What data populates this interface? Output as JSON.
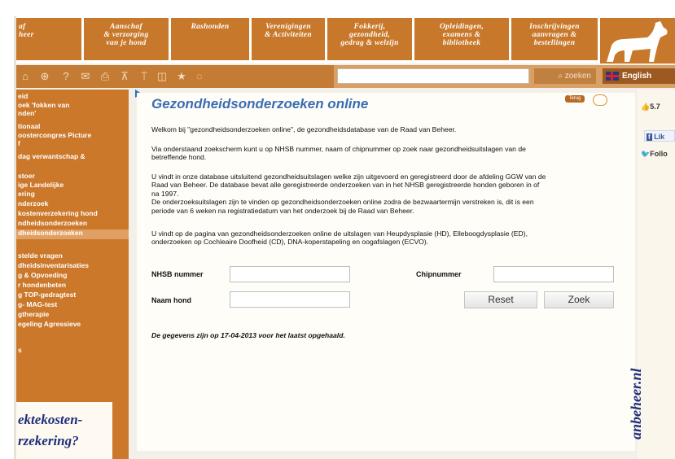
{
  "nav": {
    "items": [
      "af\nheer",
      "Aanschaf\n& verzorging\nvan je hond",
      "Rashonden",
      "Verenigingen\n& Activiteiten",
      "Fokkerij,\ngezondheid,\ngedrag & welzijn",
      "Opleidingen,\nexamens &\nbibliotheek",
      "Inschrijvingen\naanvragen &\nbestellingen"
    ]
  },
  "toolbar": {
    "icons": [
      "home-icon",
      "globe-icon",
      "help-icon",
      "mail-icon",
      "print-icon",
      "sitemap-icon",
      "pin-icon",
      "text-size-icon",
      "star-icon",
      "chat-icon"
    ],
    "search_button": "zoeken",
    "language": "English"
  },
  "sidebar": {
    "items": [
      "eid",
      "oek 'fokken van",
      "nden'",
      "tionaal",
      "oostercongres Picture",
      "f",
      "dag verwantschap &",
      "",
      "stoer",
      "ige Landelijke",
      "ering",
      "nderzoek",
      "kostenverzekering hond",
      "ndheidsonderzoeken",
      "dheidsonderzoeken",
      "",
      "stelde vragen",
      "dheidsinventarisaties",
      "g & Opvoeding",
      "r hondenbeten",
      "g TOP-gedragtest",
      "g- MAG-test",
      "gtherapie",
      "egeling Agressieve",
      "",
      "s"
    ],
    "active_index": 14,
    "promo_lines": [
      "ektekosten-",
      "rzekering?"
    ]
  },
  "main": {
    "title": "Gezondheidsonderzoeken online",
    "badge": "Terug",
    "paragraphs": [
      "Welkom bij \"gezondheidsonderzoeken online\", de gezondheidsdatabase van de Raad van Beheer.",
      "Via onderstaand zoekscherm kunt u op NHSB nummer, naam of chipnummer op zoek naar gezondheidsuitslagen van de\nbetreffende hond.",
      "U vindt in onze database uitsluitend gezondheidsuitslagen welke zijn uitgevoerd en geregistreerd door de afdeling GGW van de\nRaad van Beheer. De database bevat alle geregistreerde onderzoeken van in het NHSB geregistreerde honden geboren in of\nna 1997.\nDe onderzoeksuitslagen zijn te vinden op  gezondheidsonderzoeken online zodra de bezwaartermijn verstreken is, dit is een\nperiode van 6 weken na registratiedatum van het onderzoek bij de Raad van Beheer.",
      "U vindt op de pagina van gezondheidsonderzoeken online de uitslagen van Heupdysplasie (HD), Elleboogdysplasie (ED),\nonderzoeken op Cochleaire Doofheid (CD), DNA-koperstapeling en oogafslagen (ECVO)."
    ],
    "form": {
      "nhsb_label": "NHSB nummer",
      "chip_label": "Chipnummer",
      "name_label": "Naam hond",
      "nhsb_value": "",
      "chip_value": "",
      "name_value": "",
      "reset_label": "Reset",
      "search_label": "Zoek"
    },
    "date_note": "De gegevens zijn op 17-04-2013 voor het laatst opgehaald."
  },
  "social": {
    "like_count": "5.7",
    "fb_like": "Lik",
    "twitter": "Follo",
    "site_vertical": "anbeheer.nl"
  },
  "colors": {
    "brand_orange": "#c8782a",
    "title_blue": "#3a6db5",
    "navy": "#1f2f7a"
  }
}
